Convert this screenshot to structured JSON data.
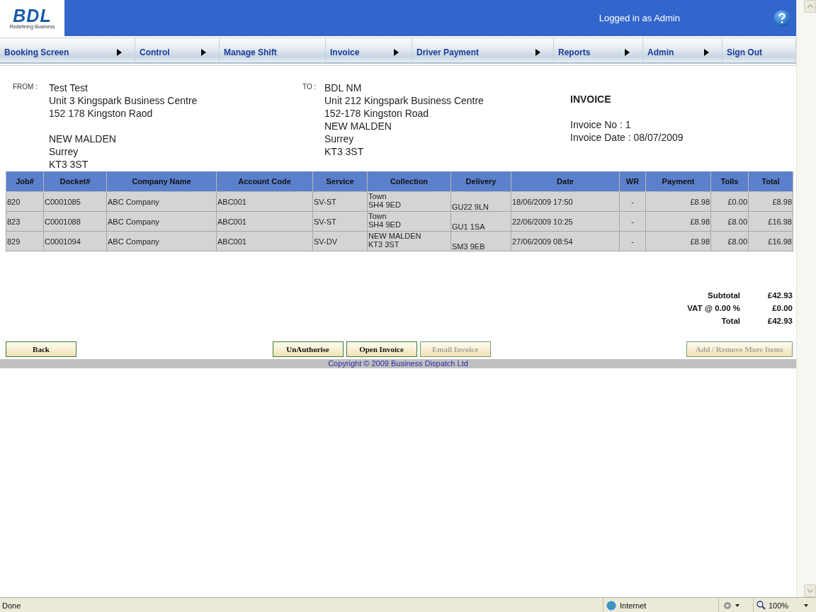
{
  "header": {
    "logo": "BDL",
    "tagline": "Redefining Business",
    "user_status": "Logged in as Admin"
  },
  "nav": [
    {
      "label": "Booking Screen",
      "submenu": true
    },
    {
      "label": "Control",
      "submenu": true
    },
    {
      "label": "Manage Shift",
      "submenu": false
    },
    {
      "label": "Invoice",
      "submenu": true
    },
    {
      "label": "Driver Payment",
      "submenu": true
    },
    {
      "label": "Reports",
      "submenu": true
    },
    {
      "label": "Admin",
      "submenu": true
    },
    {
      "label": "Sign Out",
      "submenu": false
    }
  ],
  "from": {
    "label": "FROM :",
    "name": "Test Test",
    "address_lines": [
      "Unit 3 Kingspark Business Centre",
      "152 178 Kingston Raod"
    ],
    "city_lines": [
      "NEW MALDEN",
      "Surrey",
      "KT3 3ST"
    ]
  },
  "to": {
    "label": "TO :",
    "name": "BDL NM",
    "address_lines": [
      "Unit 212 Kingspark Business Centre",
      "152-178 Kingston Road",
      "NEW MALDEN",
      "Surrey",
      "KT3 3ST"
    ]
  },
  "invoice": {
    "title": "INVOICE",
    "number": "Invoice No : 1",
    "date": "Invoice Date : 08/07/2009"
  },
  "table": {
    "columns": [
      "Job#",
      "Docket#",
      "Company Name",
      "Account Code",
      "Service",
      "Collection",
      "Delivery",
      "Date",
      "WR",
      "Payment",
      "Tolls",
      "Total"
    ],
    "rows": [
      {
        "job": "820",
        "docket": "C0001085",
        "company": "ABC Company",
        "account": "ABC001",
        "service": "SV-ST",
        "collection": [
          "Town",
          "SH4 9ED"
        ],
        "delivery": "GU22 9LN",
        "date": "18/06/2009 17:50",
        "wr": "-",
        "payment": "£8.98",
        "tolls": "£0.00",
        "total": "£8.98"
      },
      {
        "job": "823",
        "docket": "C0001088",
        "company": "ABC Company",
        "account": "ABC001",
        "service": "SV-ST",
        "collection": [
          "Town",
          "SH4 9ED"
        ],
        "delivery": "GU1 1SA",
        "date": "22/06/2009 10:25",
        "wr": "-",
        "payment": "£8.98",
        "tolls": "£8.00",
        "total": "£16.98"
      },
      {
        "job": "829",
        "docket": "C0001094",
        "company": "ABC Company",
        "account": "ABC001",
        "service": "SV-DV",
        "collection": [
          "NEW MALDEN",
          "KT3 3ST"
        ],
        "delivery": "SM3 9EB",
        "date": "27/06/2009 08:54",
        "wr": "-",
        "payment": "£8.98",
        "tolls": "£8.00",
        "total": "£16.98"
      }
    ]
  },
  "totals": [
    {
      "label": "Subtotal",
      "value": "£42.93"
    },
    {
      "label": "VAT @ 0.00 %",
      "value": "£0.00"
    },
    {
      "label": "Total",
      "value": "£42.93"
    }
  ],
  "button_groups": [
    {
      "buttons": [
        {
          "label": "Back",
          "disabled": false
        }
      ]
    },
    {
      "buttons": [
        {
          "label": "UnAuthorise",
          "disabled": false
        },
        {
          "label": "Open Invoice",
          "disabled": false
        },
        {
          "label": "Email Invoice",
          "disabled": true
        }
      ]
    },
    {
      "buttons": [
        {
          "label": "Add / Remove More Items",
          "disabled": true
        }
      ]
    }
  ],
  "footer": "Copyright © 2009 Business Dispatch Ltd",
  "status_bar": {
    "status": "Done",
    "zone": "Internet",
    "zoom": "100%"
  }
}
